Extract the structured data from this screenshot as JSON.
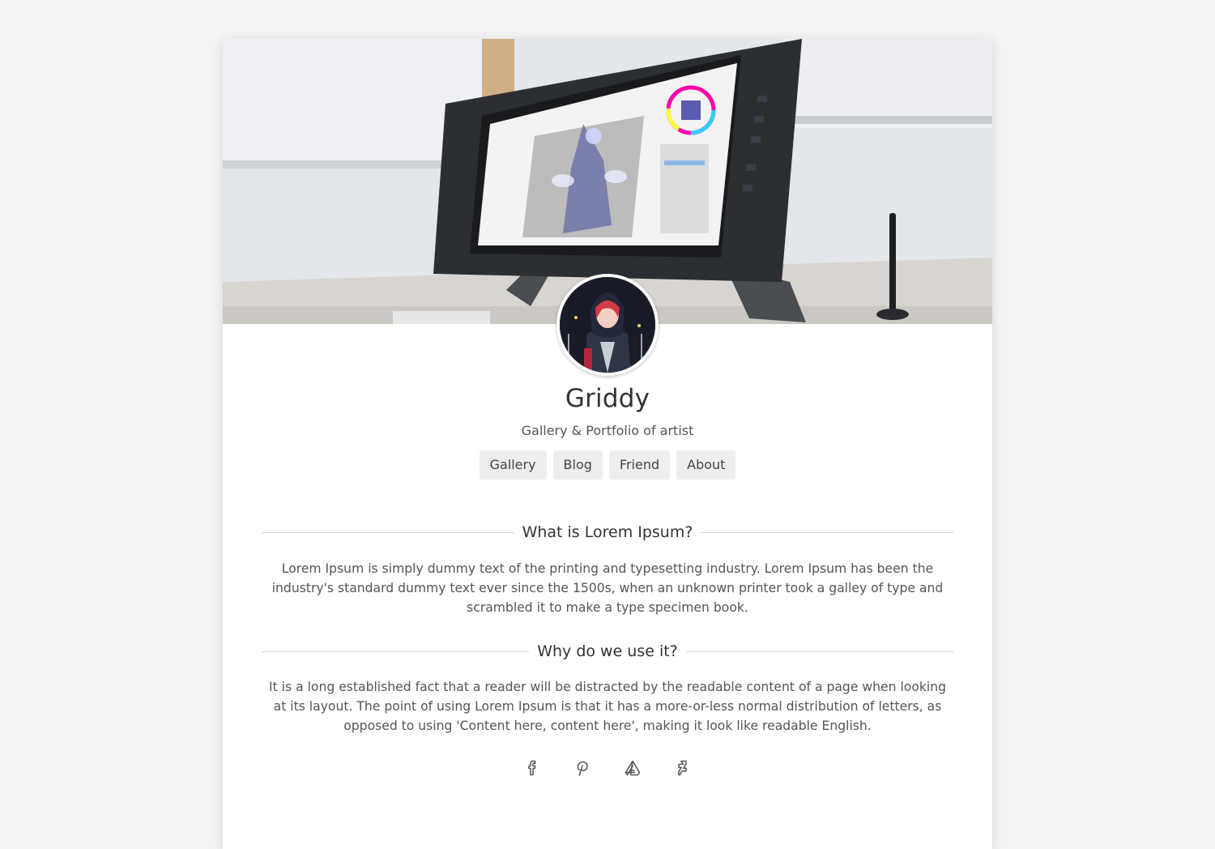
{
  "profile": {
    "name": "Griddy",
    "tagline": "Gallery & Portfolio of artist"
  },
  "nav": {
    "items": [
      {
        "label": "Gallery"
      },
      {
        "label": "Blog"
      },
      {
        "label": "Friend"
      },
      {
        "label": "About"
      }
    ]
  },
  "sections": [
    {
      "title": "What is Lorem Ipsum?",
      "body": "Lorem Ipsum is simply dummy text of the printing and typesetting industry. Lorem Ipsum has been the industry's standard dummy text ever since the 1500s, when an unknown printer took a galley of type and scrambled it to make a type specimen book."
    },
    {
      "title": "Why do we use it?",
      "body": "It is a long established fact that a reader will be distracted by the readable content of a page when looking at its layout. The point of using Lorem Ipsum is that it has a more-or-less normal distribution of letters, as opposed to using 'Content here, content here', making it look like readable English."
    }
  ],
  "social": [
    {
      "icon": "facebook-icon"
    },
    {
      "icon": "pinterest-icon"
    },
    {
      "icon": "artstation-icon"
    },
    {
      "icon": "deviantart-icon"
    }
  ],
  "colors": {
    "page_background": "#f4f4f4",
    "card_background": "#ffffff",
    "button_background": "#eeeeee",
    "text_primary": "#333333",
    "text_secondary": "#555555"
  }
}
